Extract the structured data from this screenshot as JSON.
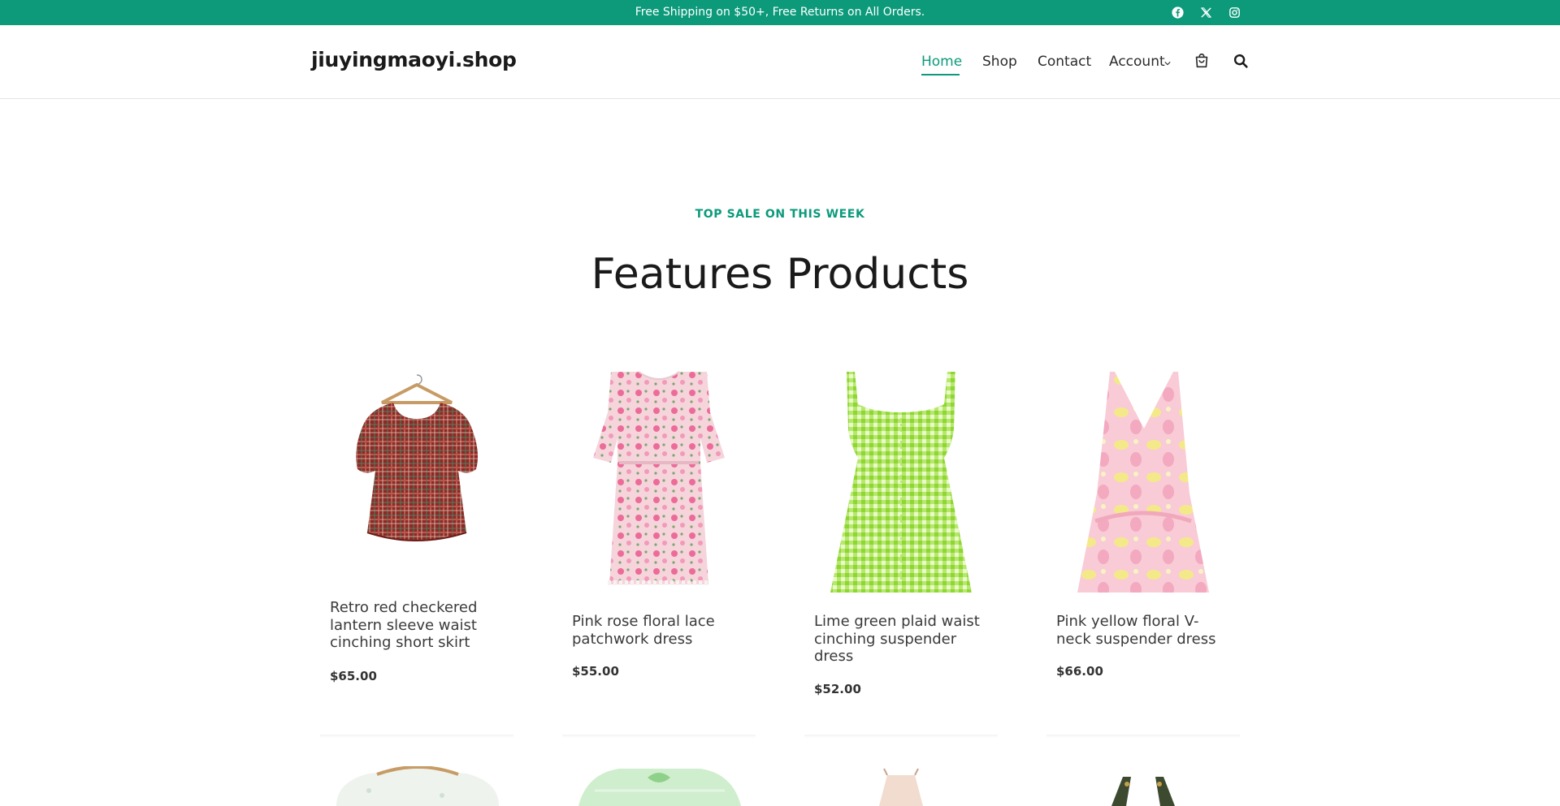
{
  "topbar": {
    "message": "Free Shipping on $50+, Free Returns on All Orders.",
    "social": [
      "facebook-icon",
      "x-twitter-icon",
      "instagram-icon"
    ]
  },
  "header": {
    "logo": "jiuyingmaoyi.shop",
    "nav": [
      {
        "label": "Home",
        "active": true
      },
      {
        "label": "Shop",
        "active": false
      },
      {
        "label": "Contact",
        "active": false
      },
      {
        "label": "Account",
        "active": false
      }
    ],
    "icons": [
      "shopping-bag-icon",
      "search-icon"
    ]
  },
  "section": {
    "eyebrow": "TOP SALE ON THIS WEEK",
    "title": "Features Products"
  },
  "products": [
    {
      "name": "Retro red checkered lantern sleeve waist cinching short skirt",
      "price": "$65.00"
    },
    {
      "name": "Pink rose floral lace patchwork dress",
      "price": "$55.00"
    },
    {
      "name": "Lime green plaid waist cinching suspender dress",
      "price": "$52.00"
    },
    {
      "name": "Pink yellow floral V-neck suspender dress",
      "price": "$66.00"
    }
  ],
  "colors": {
    "accent": "#0c9a7b",
    "text": "#1f1f1f"
  }
}
